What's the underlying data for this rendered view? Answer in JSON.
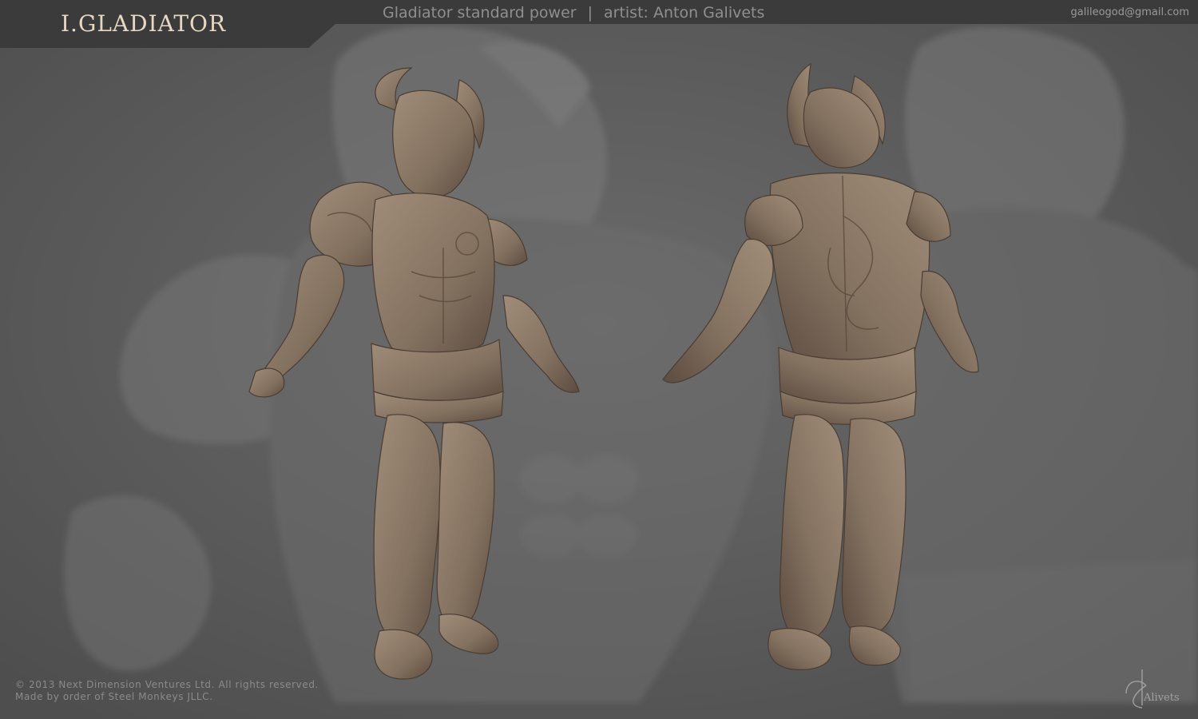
{
  "header": {
    "title": "I.GLADIATOR",
    "subtitle": "Gladiator standard power",
    "separator": "|",
    "artist": "artist: Anton Galivets",
    "email": "galileogod@gmail.com"
  },
  "footer": {
    "copyright_line1": "© 2013 Next Dimension Ventures Ltd. All rights reserved.",
    "copyright_line2": "Made by order of Steel Monkeys JLLC.",
    "signature": "Alivets"
  },
  "colors": {
    "background": "#5f5f5f",
    "header_bar": "#3b3b3b",
    "title_text": "#e7d7c3",
    "model_clay": "#8e7b69",
    "model_shadow": "#5a4b3f"
  },
  "images": {
    "front_view": "gladiator-front-render",
    "back_view": "gladiator-back-render",
    "background": "gladiator-closeup-background"
  }
}
